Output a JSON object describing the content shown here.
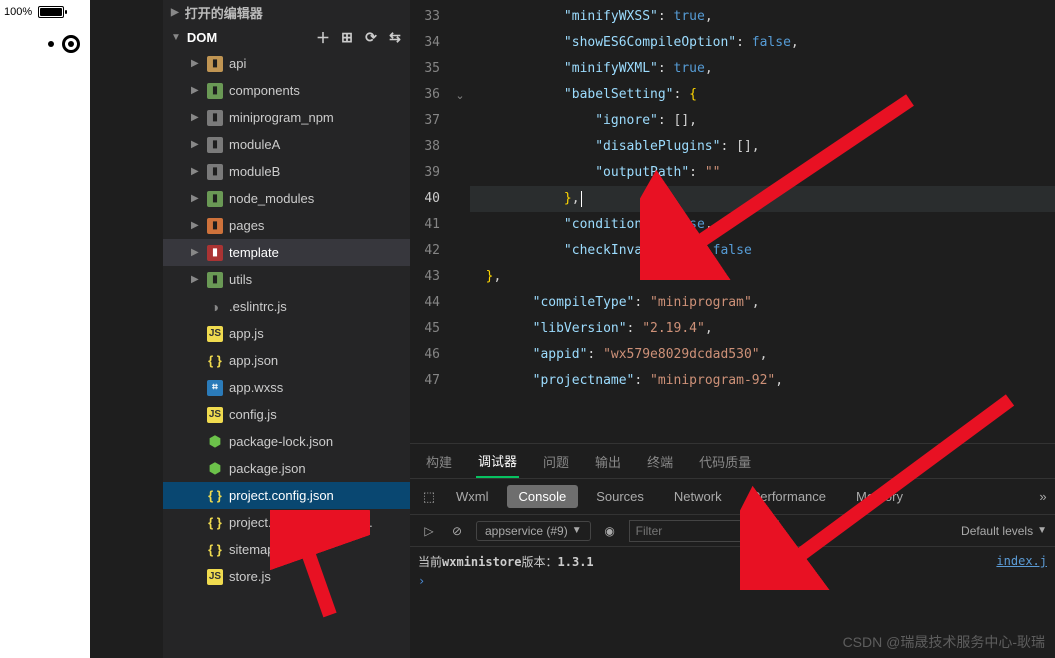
{
  "topbar": {
    "battery_pct": "100%"
  },
  "sidebar": {
    "open_editors": "打开的编辑器",
    "root": "DOM",
    "folders": [
      {
        "name": "api",
        "icon": "folder-yellow",
        "expandable": true
      },
      {
        "name": "components",
        "icon": "folder-green",
        "expandable": true
      },
      {
        "name": "miniprogram_npm",
        "icon": "folder-gray",
        "expandable": true
      },
      {
        "name": "moduleA",
        "icon": "folder-gray",
        "expandable": true
      },
      {
        "name": "moduleB",
        "icon": "folder-gray",
        "expandable": true
      },
      {
        "name": "node_modules",
        "icon": "folder-green",
        "expandable": true
      },
      {
        "name": "pages",
        "icon": "folder-orange",
        "expandable": true
      },
      {
        "name": "template",
        "icon": "folder-red",
        "expandable": true,
        "selected": true
      },
      {
        "name": "utils",
        "icon": "folder-green",
        "expandable": true
      }
    ],
    "files": [
      {
        "name": ".eslintrc.js",
        "icon": "config"
      },
      {
        "name": "app.js",
        "icon": "js"
      },
      {
        "name": "app.json",
        "icon": "json"
      },
      {
        "name": "app.wxss",
        "icon": "wxss"
      },
      {
        "name": "config.js",
        "icon": "js"
      },
      {
        "name": "package-lock.json",
        "icon": "node"
      },
      {
        "name": "package.json",
        "icon": "node"
      },
      {
        "name": "project.config.json",
        "icon": "json",
        "active": true
      },
      {
        "name": "project.private.config.js...",
        "icon": "json"
      },
      {
        "name": "sitemap.json",
        "icon": "json"
      },
      {
        "name": "store.js",
        "icon": "js"
      }
    ]
  },
  "editor": {
    "lines": [
      {
        "n": 33,
        "indent": 3,
        "key": "minifyWXSS",
        "val": "true",
        "type": "bool",
        "comma": true
      },
      {
        "n": 34,
        "indent": 3,
        "key": "showES6CompileOption",
        "val": "false",
        "type": "bool",
        "comma": true
      },
      {
        "n": 35,
        "indent": 3,
        "key": "minifyWXML",
        "val": "true",
        "type": "bool",
        "comma": true
      },
      {
        "n": 36,
        "indent": 3,
        "key": "babelSetting",
        "type": "open",
        "fold": true
      },
      {
        "n": 37,
        "indent": 4,
        "key": "ignore",
        "val": "[]",
        "type": "raw",
        "comma": true
      },
      {
        "n": 38,
        "indent": 4,
        "key": "disablePlugins",
        "val": "[]",
        "type": "raw",
        "comma": true
      },
      {
        "n": 39,
        "indent": 4,
        "key": "outputPath",
        "val": "",
        "type": "str"
      },
      {
        "n": 40,
        "indent": 3,
        "type": "close",
        "comma": true,
        "cursor": true
      },
      {
        "n": 41,
        "indent": 3,
        "key": "condition",
        "val": "false",
        "type": "bool",
        "comma": true
      },
      {
        "n": 42,
        "indent": 3,
        "key": "checkInvalidKey",
        "val": "false",
        "type": "bool"
      },
      {
        "n": 43,
        "indent": 2,
        "type": "close2",
        "comma": true
      },
      {
        "n": 44,
        "indent": 2,
        "key": "compileType",
        "val": "miniprogram",
        "type": "str",
        "comma": true
      },
      {
        "n": 45,
        "indent": 2,
        "key": "libVersion",
        "val": "2.19.4",
        "type": "str",
        "comma": true
      },
      {
        "n": 46,
        "indent": 2,
        "key": "appid",
        "val": "wx579e8029dcdad530",
        "type": "str",
        "comma": true
      },
      {
        "n": 47,
        "indent": 2,
        "key": "projectname",
        "val": "miniprogram-92",
        "type": "str",
        "comma": true
      }
    ]
  },
  "panel": {
    "tabs1": [
      "构建",
      "调试器",
      "问题",
      "输出",
      "终端",
      "代码质量"
    ],
    "tabs1_active": 1,
    "tabs2": [
      "Wxml",
      "Console",
      "Sources",
      "Network",
      "Performance",
      "Memory"
    ],
    "tabs2_active": 1,
    "context": "appservice (#9)",
    "filter_placeholder": "Filter",
    "levels": "Default levels",
    "console_msg_prefix": "当前",
    "console_msg_bold": "wxministore",
    "console_msg_mid": "版本：",
    "console_msg_ver": "1.3.1",
    "console_link": "index.j"
  },
  "watermark": "CSDN @瑞晟技术服务中心-耿瑞"
}
